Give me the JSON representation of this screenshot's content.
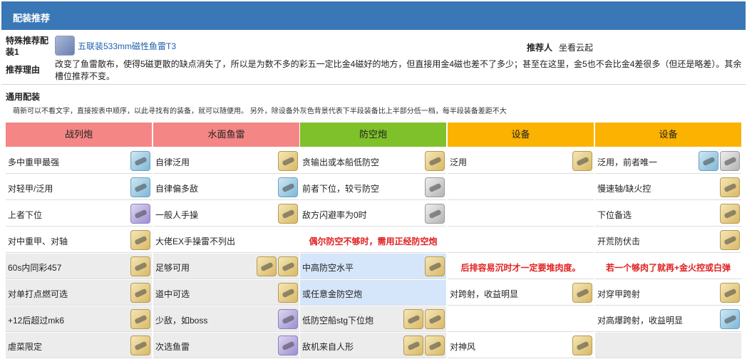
{
  "header": {
    "title": "配装推荐"
  },
  "special": {
    "label": "特殊推荐配装1",
    "equip_name": "五联装533mm磁性鱼雷T3",
    "recommender_label": "推荐人",
    "recommender_name": "坐看云起",
    "reason_label": "推荐理由",
    "reason_text": "改变了鱼雷散布，使得5磁更散的缺点消失了，所以是为数不多的彩五一定比金4磁好的地方，但直接用金4磁也差不了多少；甚至在这里，金5也不会比金4差很多（但还是略差）。其余槽位推荐不变。"
  },
  "general": {
    "title": "通用配装",
    "note": "萌新可以不看文字，直接按表中顺序，以此寻找有的装备，就可以随便用。 另外，除设备外灰色背景代表下半段装备比上半部分低一档，每半段装备差距不大"
  },
  "colors": {
    "battleship": "#f48685",
    "torpedo": "#f48685",
    "aa": "#7ec12a",
    "aux1": "#fbb200",
    "aux2": "#fbb200"
  },
  "columns": [
    {
      "header": "战列炮",
      "color": "#f48685"
    },
    {
      "header": "水面鱼雷",
      "color": "#f48685"
    },
    {
      "header": "防空炮",
      "color": "#7ec12a"
    },
    {
      "header": "设备",
      "color": "#fbb200"
    },
    {
      "header": "设备",
      "color": "#fbb200"
    }
  ],
  "rows": [
    [
      {
        "text": "多中重甲最强",
        "bg": "white",
        "icons": [
          "blue"
        ]
      },
      {
        "text": "自律泛用",
        "bg": "white",
        "icons": [
          "gold"
        ]
      },
      {
        "text": "贪输出或本船低防空",
        "bg": "white",
        "icons": [
          "gold"
        ]
      },
      {
        "text": "泛用",
        "bg": "white",
        "icons": [
          "gold"
        ]
      },
      {
        "text": "泛用，前者唯一",
        "bg": "white",
        "icons": [
          "blue",
          "silver"
        ]
      }
    ],
    [
      {
        "text": "对轻甲/泛用",
        "bg": "white",
        "icons": [
          "blue"
        ]
      },
      {
        "text": "自律偏多敌",
        "bg": "white",
        "icons": [
          "blue"
        ]
      },
      {
        "text": "前者下位，较亏防空",
        "bg": "white",
        "icons": [
          "silver"
        ]
      },
      {
        "text": "",
        "bg": "white",
        "icons": []
      },
      {
        "text": "慢速轴/缺火控",
        "bg": "white",
        "icons": [
          "gold"
        ]
      }
    ],
    [
      {
        "text": "上者下位",
        "bg": "white",
        "icons": [
          "purple"
        ]
      },
      {
        "text": "一般人手操",
        "bg": "white",
        "icons": [
          "gold"
        ]
      },
      {
        "text": "敌方闪避率为0时",
        "bg": "white",
        "icons": [
          "silver"
        ]
      },
      {
        "text": "",
        "bg": "white",
        "icons": []
      },
      {
        "text": "下位备选",
        "bg": "white",
        "icons": [
          "gold"
        ]
      }
    ],
    [
      {
        "text": "对中重甲、对轴",
        "bg": "white",
        "icons": [
          "gold"
        ]
      },
      {
        "text": "大佬EX手操雷不列出",
        "bg": "white",
        "icons": []
      },
      {
        "text": "偶尔防空不够时，需用正经防空炮",
        "bg": "white",
        "icons": [],
        "red": true
      },
      {
        "text": "",
        "bg": "white",
        "icons": []
      },
      {
        "text": "开荒防伏击",
        "bg": "white",
        "icons": [
          "gold"
        ]
      }
    ],
    [
      {
        "text": "60s内同彩457",
        "bg": "gray",
        "icons": [
          "gold"
        ]
      },
      {
        "text": "足够可用",
        "bg": "gray",
        "icons": [
          "gold",
          "gold"
        ]
      },
      {
        "text": "中高防空水平",
        "bg": "blue",
        "icons": [
          "gold"
        ]
      },
      {
        "text": "后排容易沉时才一定要堆肉度。",
        "bg": "white",
        "icons": [],
        "red": true
      },
      {
        "text": "若一个够肉了就再+金火控或白弹",
        "bg": "white",
        "icons": [],
        "red": true
      }
    ],
    [
      {
        "text": "对单打点燃可选",
        "bg": "gray",
        "icons": [
          "gold"
        ]
      },
      {
        "text": "道中可选",
        "bg": "gray",
        "icons": [
          "gold"
        ]
      },
      {
        "text": "或任意金防空炮",
        "bg": "blue",
        "icons": []
      },
      {
        "text": "对跨射，收益明显",
        "bg": "white",
        "icons": [
          "gold"
        ]
      },
      {
        "text": "对穿甲跨射",
        "bg": "white",
        "icons": [
          "gold"
        ]
      }
    ],
    [
      {
        "text": "+12后超过mk6",
        "bg": "gray",
        "icons": [
          "gold"
        ]
      },
      {
        "text": "少敌，如boss",
        "bg": "gray",
        "icons": [
          "purple"
        ]
      },
      {
        "text": "低防空船stg下位炮",
        "bg": "gray",
        "icons": [
          "gold",
          "gold"
        ]
      },
      {
        "text": "",
        "bg": "white",
        "icons": []
      },
      {
        "text": "对高爆跨射，收益明显",
        "bg": "white",
        "icons": [
          "blue"
        ]
      }
    ],
    [
      {
        "text": "虐菜限定",
        "bg": "gray",
        "icons": [
          "gold"
        ]
      },
      {
        "text": "次选鱼雷",
        "bg": "gray",
        "icons": [
          "purple"
        ]
      },
      {
        "text": "敌机来自人形",
        "bg": "gray",
        "icons": [
          "gold",
          "gold"
        ]
      },
      {
        "text": "对神风",
        "bg": "white",
        "icons": [
          "gold"
        ]
      },
      {
        "text": "",
        "bg": "gray",
        "icons": []
      }
    ]
  ]
}
